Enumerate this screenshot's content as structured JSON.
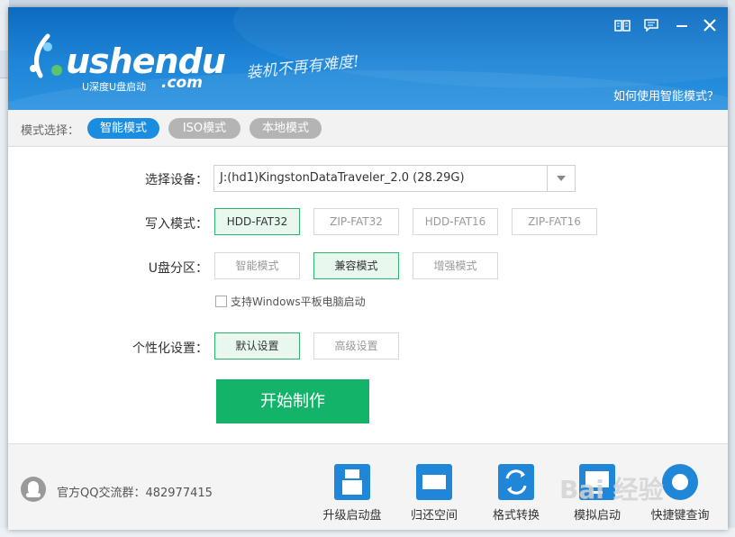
{
  "brand": {
    "logo_text": "ushendu",
    "logo_sub": "U深度U盘启动",
    "logo_com": ".com",
    "slogan": "装机不再有难度!"
  },
  "header": {
    "help_link": "如何使用智能模式？",
    "icons": [
      "book-icon",
      "chat-icon",
      "minimize-icon",
      "close-icon"
    ]
  },
  "modebar": {
    "label": "模式选择：",
    "tabs": [
      {
        "label": "智能模式",
        "active": true
      },
      {
        "label": "ISO模式",
        "active": false
      },
      {
        "label": "本地模式",
        "active": false
      }
    ]
  },
  "form": {
    "device_label": "选择设备：",
    "device_value": "J:(hd1)KingstonDataTraveler_2.0 (28.29G)",
    "write_label": "写入模式：",
    "write_options": [
      {
        "label": "HDD-FAT32",
        "selected": true
      },
      {
        "label": "ZIP-FAT32",
        "selected": false
      },
      {
        "label": "HDD-FAT16",
        "selected": false
      },
      {
        "label": "ZIP-FAT16",
        "selected": false
      }
    ],
    "partition_label": "U盘分区：",
    "partition_options": [
      {
        "label": "智能模式",
        "selected": false
      },
      {
        "label": "兼容模式",
        "selected": true
      },
      {
        "label": "增强模式",
        "selected": false
      }
    ],
    "tablet_checkbox": "支持Windows平板电脑启动",
    "tablet_checked": false,
    "personal_label": "个性化设置：",
    "personal_options": [
      {
        "label": "默认设置",
        "selected": true
      },
      {
        "label": "高级设置",
        "selected": false
      }
    ],
    "start_button": "开始制作"
  },
  "footer": {
    "qq_group": "官方QQ交流群：482977415",
    "tools": [
      {
        "label": "升级启动盘",
        "icon": "upgrade-disk-icon"
      },
      {
        "label": "归还空间",
        "icon": "restore-space-icon"
      },
      {
        "label": "格式转换",
        "icon": "format-convert-icon"
      },
      {
        "label": "模拟启动",
        "icon": "simulate-boot-icon"
      },
      {
        "label": "快捷键查询",
        "icon": "hotkey-search-icon"
      }
    ]
  },
  "watermark": "Bai 经验",
  "colors": {
    "accent": "#1a8de0",
    "header": "#1f86d8",
    "start": "#14b36a",
    "selected_border": "#2fb36d"
  }
}
